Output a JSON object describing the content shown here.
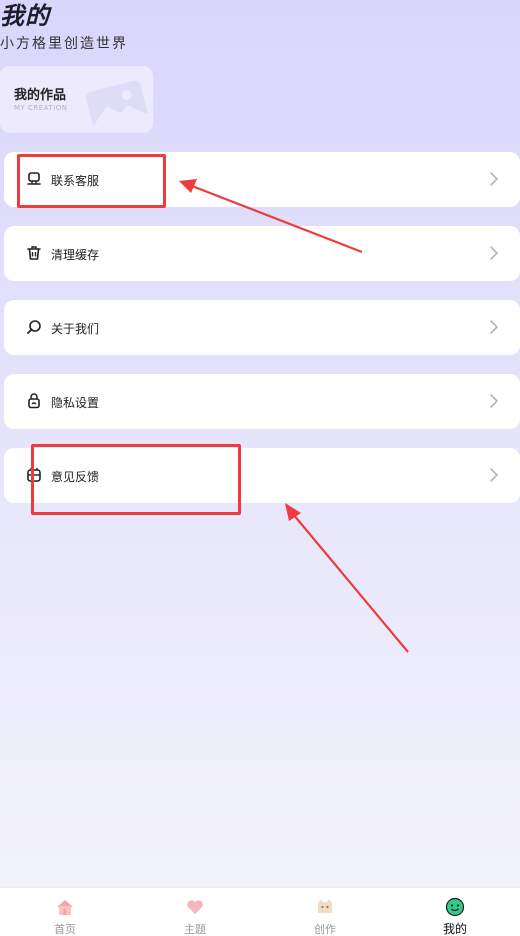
{
  "header": {
    "title": "我的",
    "subtitle": "小方格里创造世界"
  },
  "creation_card": {
    "title": "我的作品",
    "subtitle": "MY CREATION"
  },
  "menu": {
    "items": [
      {
        "label": "联系客服",
        "icon": "headset-icon"
      },
      {
        "label": "清理缓存",
        "icon": "trash-icon"
      },
      {
        "label": "关于我们",
        "icon": "search-chat-icon"
      },
      {
        "label": "隐私设置",
        "icon": "lock-icon"
      },
      {
        "label": "意见反馈",
        "icon": "feedback-icon"
      }
    ]
  },
  "tabbar": {
    "tabs": [
      {
        "label": "首页",
        "icon": "home-icon",
        "active": false
      },
      {
        "label": "主题",
        "icon": "heart-icon",
        "active": false
      },
      {
        "label": "创作",
        "icon": "cat-icon",
        "active": false
      },
      {
        "label": "我的",
        "icon": "smiley-icon",
        "active": true
      }
    ]
  },
  "colors": {
    "annotation_red": "#ee3b3b",
    "active_tab_icon": "#37c98a"
  }
}
